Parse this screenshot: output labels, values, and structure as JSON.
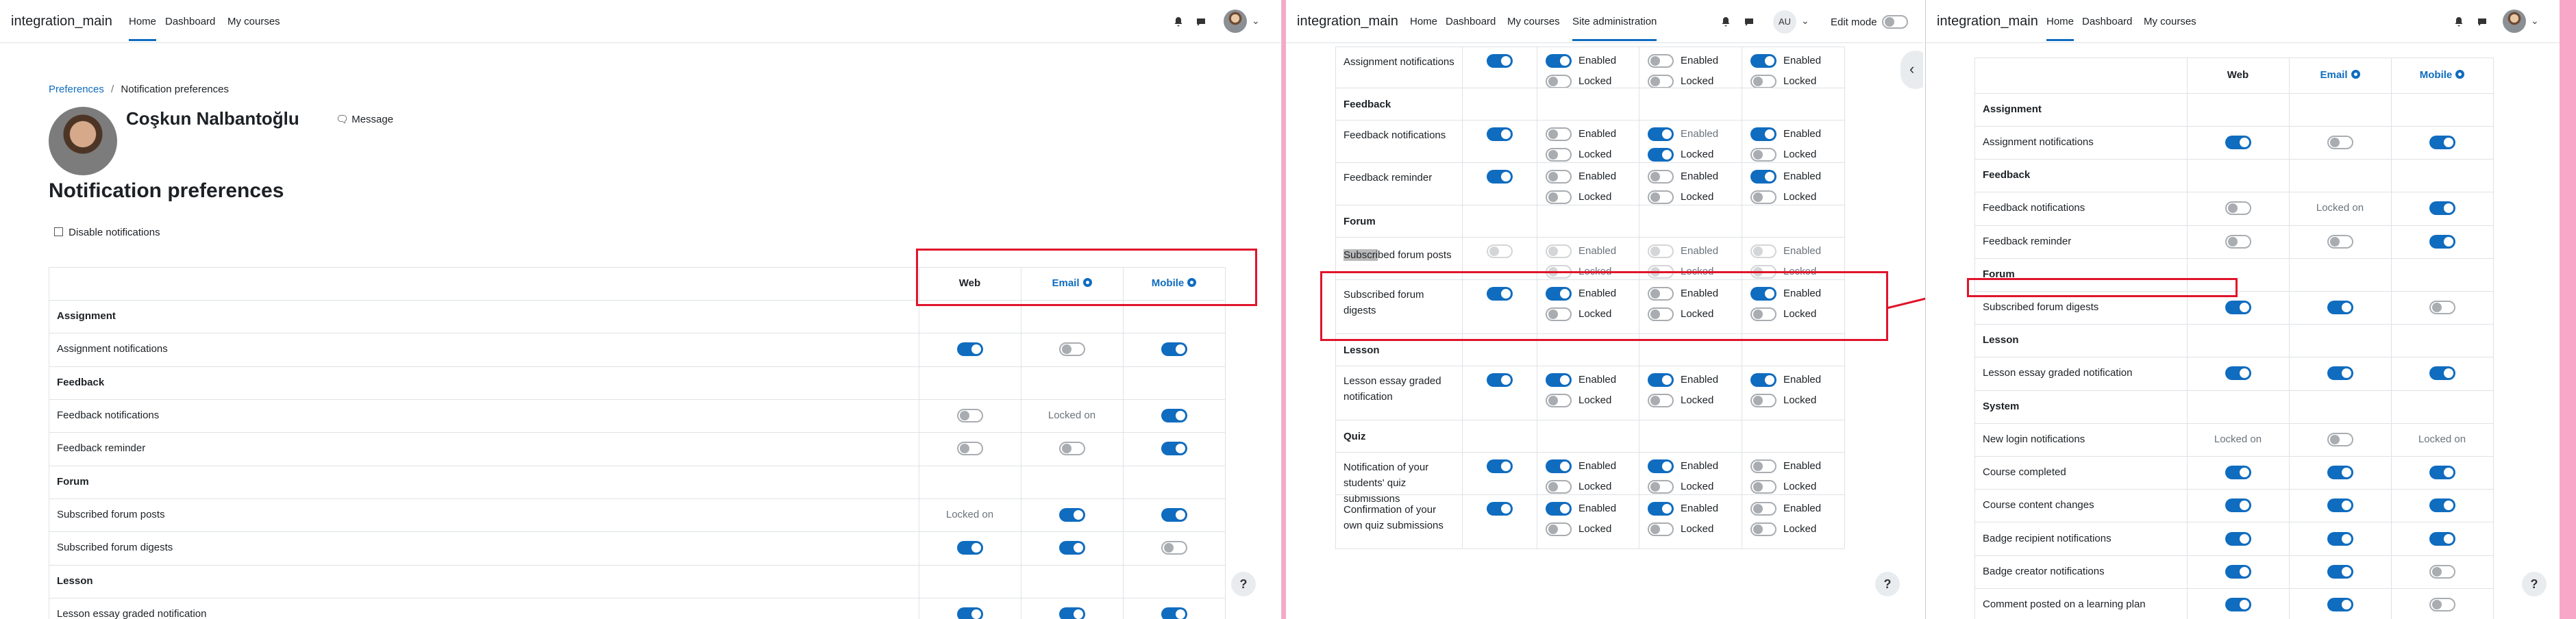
{
  "panel1": {
    "brand": "integration_main",
    "nav": [
      "Home",
      "Dashboard",
      "My courses"
    ],
    "breadcrumb": [
      "Preferences",
      "Notification preferences"
    ],
    "user_name": "Coşkun Nalbantoğlu",
    "message_label": "Message",
    "page_title": "Notification preferences",
    "disable_label": "Disable notifications",
    "columns": [
      "Web",
      "Email",
      "Mobile"
    ],
    "rows": [
      {
        "type": "section",
        "label": "Assignment"
      },
      {
        "type": "item",
        "label": "Assignment notifications",
        "web": "on",
        "email": "off",
        "mobile": "on"
      },
      {
        "type": "section",
        "label": "Feedback"
      },
      {
        "type": "item",
        "label": "Feedback notifications",
        "web": "off",
        "email": "Locked on",
        "mobile": "on"
      },
      {
        "type": "item",
        "label": "Feedback reminder",
        "web": "off",
        "email": "off",
        "mobile": "on"
      },
      {
        "type": "section",
        "label": "Forum"
      },
      {
        "type": "item",
        "label": "Subscribed forum posts",
        "web": "Locked on",
        "email": "on",
        "mobile": "on"
      },
      {
        "type": "item",
        "label": "Subscribed forum digests",
        "web": "on",
        "email": "on",
        "mobile": "off"
      },
      {
        "type": "section",
        "label": "Lesson"
      },
      {
        "type": "item",
        "label": "Lesson essay graded notification",
        "web": "on",
        "email": "on",
        "mobile": "on"
      }
    ]
  },
  "panel2": {
    "brand": "integration_main",
    "nav": [
      "Home",
      "Dashboard",
      "My courses",
      "Site administration"
    ],
    "user_initials": "AU",
    "edit_mode_label": "Edit mode",
    "enabled_label": "Enabled",
    "locked_label": "Locked",
    "selected_text": "Subscri",
    "rows": [
      {
        "type": "item",
        "label": [
          "Assignment notifications"
        ],
        "web": "on",
        "cols": [
          [
            "on",
            "off"
          ],
          [
            "off",
            "off"
          ],
          [
            "on",
            "off"
          ]
        ]
      },
      {
        "type": "section",
        "label": "Feedback"
      },
      {
        "type": "item",
        "label": [
          "Feedback notifications"
        ],
        "web": "on",
        "cols": [
          [
            "off",
            "off"
          ],
          [
            "on",
            "on"
          ],
          [
            "on",
            "off"
          ]
        ],
        "muted_enabled": [
          false,
          true,
          false
        ]
      },
      {
        "type": "item",
        "label": [
          "Feedback reminder"
        ],
        "web": "on",
        "cols": [
          [
            "off",
            "off"
          ],
          [
            "off",
            "off"
          ],
          [
            "on",
            "off"
          ]
        ]
      },
      {
        "type": "section",
        "label": "Forum"
      },
      {
        "type": "item",
        "label": [
          "bed forum posts"
        ],
        "selected": true,
        "web": "offdis",
        "cols": [
          [
            "offdis",
            "offdis"
          ],
          [
            "offdis",
            "offdis"
          ],
          [
            "offdis",
            "offdis"
          ]
        ],
        "muted": true
      },
      {
        "type": "item",
        "label": [
          "Subscribed forum",
          "digests"
        ],
        "web": "on",
        "cols": [
          [
            "on",
            "off"
          ],
          [
            "off",
            "off"
          ],
          [
            "on",
            "off"
          ]
        ]
      },
      {
        "type": "section",
        "label": "Lesson"
      },
      {
        "type": "item",
        "label": [
          "Lesson essay graded",
          "notification"
        ],
        "web": "on",
        "cols": [
          [
            "on",
            "off"
          ],
          [
            "on",
            "off"
          ],
          [
            "on",
            "off"
          ]
        ]
      },
      {
        "type": "section",
        "label": "Quiz"
      },
      {
        "type": "item",
        "label": [
          "Notification of your",
          "students' quiz",
          "submissions"
        ],
        "web": "on",
        "cols": [
          [
            "on",
            "off"
          ],
          [
            "on",
            "off"
          ],
          [
            "off",
            "off"
          ]
        ]
      },
      {
        "type": "item",
        "label": [
          "Confirmation of your",
          "own quiz submissions"
        ],
        "web": "on",
        "cols": [
          [
            "on",
            "off"
          ],
          [
            "on",
            "off"
          ],
          [
            "off",
            "off"
          ]
        ]
      }
    ]
  },
  "panel3": {
    "brand": "integration_main",
    "nav": [
      "Home",
      "Dashboard",
      "My courses"
    ],
    "columns": [
      "Web",
      "Email",
      "Mobile"
    ],
    "rows": [
      {
        "type": "section",
        "label": "Assignment"
      },
      {
        "type": "item",
        "label": "Assignment notifications",
        "web": "on",
        "email": "off",
        "mobile": "on"
      },
      {
        "type": "section",
        "label": "Feedback"
      },
      {
        "type": "item",
        "label": "Feedback notifications",
        "web": "off",
        "email": "Locked on",
        "mobile": "on"
      },
      {
        "type": "item",
        "label": "Feedback reminder",
        "web": "off",
        "email": "off",
        "mobile": "on"
      },
      {
        "type": "section",
        "label": "Forum"
      },
      {
        "type": "item",
        "label": "Subscribed forum digests",
        "web": "on",
        "email": "on",
        "mobile": "off"
      },
      {
        "type": "section",
        "label": "Lesson"
      },
      {
        "type": "item",
        "label": "Lesson essay graded notification",
        "web": "on",
        "email": "on",
        "mobile": "on"
      },
      {
        "type": "section",
        "label": "System"
      },
      {
        "type": "item",
        "label": "New login notifications",
        "web": "Locked on",
        "email": "off",
        "mobile": "Locked on"
      },
      {
        "type": "item",
        "label": "Course completed",
        "web": "on",
        "email": "on",
        "mobile": "on"
      },
      {
        "type": "item",
        "label": "Course content changes",
        "web": "on",
        "email": "on",
        "mobile": "on"
      },
      {
        "type": "item",
        "label": "Badge recipient notifications",
        "web": "on",
        "email": "on",
        "mobile": "on"
      },
      {
        "type": "item",
        "label": "Badge creator notifications",
        "web": "on",
        "email": "on",
        "mobile": "off"
      },
      {
        "type": "item",
        "label": "Comment posted on a learning plan",
        "web": "on",
        "email": "on",
        "mobile": "off"
      }
    ]
  },
  "help_label": "?",
  "colors": {
    "accent": "#0f6cbf",
    "annotation": "#e0142b",
    "divider": "#f7a8c8"
  }
}
